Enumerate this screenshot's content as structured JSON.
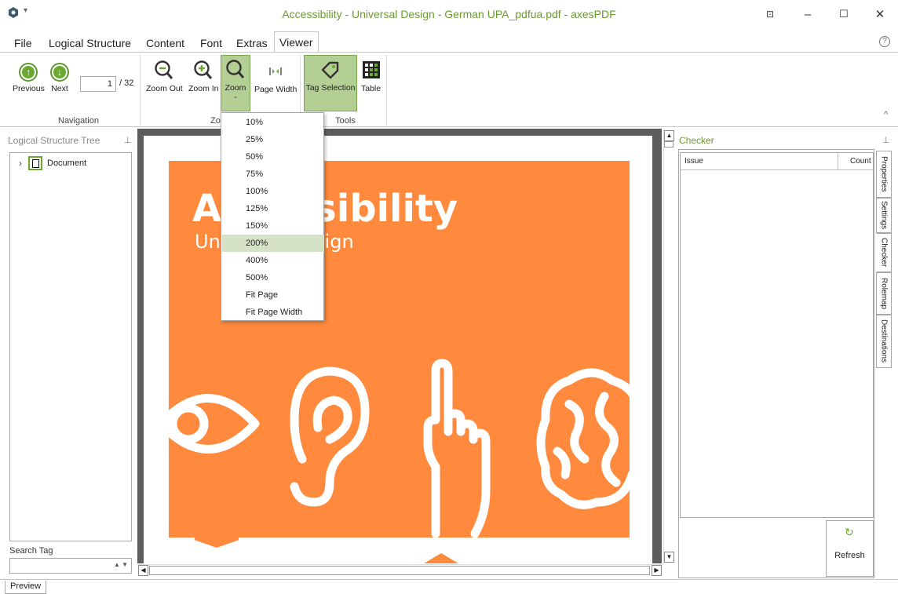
{
  "window": {
    "title": "Accessibility - Universal Design - German UPA_pdfua.pdf - axesPDF",
    "qa_dropdown": "▾",
    "buttons": {
      "restore": "⊡",
      "minimize": "–",
      "maximize": "☐",
      "close": "✕"
    }
  },
  "menu": {
    "file": "File",
    "logical_structure": "Logical Structure",
    "content": "Content",
    "font": "Font",
    "extras": "Extras",
    "viewer": "Viewer",
    "help": "?"
  },
  "ribbon": {
    "navigation": {
      "label": "Navigation",
      "previous": "Previous",
      "next": "Next",
      "page_value": "1",
      "page_total": "/ 32"
    },
    "zoom": {
      "label": "Zoom",
      "zoom_out": "Zoom Out",
      "zoom_in": "Zoom In",
      "zoom": "Zoom",
      "page_width": "Page Width"
    },
    "tools": {
      "label": "Tools",
      "tag_selection": "Tag Selection",
      "table": "Table"
    },
    "collapse": "^"
  },
  "left_panel": {
    "title": "Logical Structure Tree",
    "pin": "⊥",
    "tree": [
      {
        "label": "Document",
        "expand": "›"
      }
    ],
    "search_tag_label": "Search Tag",
    "search_tag_value": ""
  },
  "document": {
    "cover_title": "Accessibility",
    "cover_subtitle": "Universal Design",
    "accent_color": "#ff893c"
  },
  "zoom_dropdown": {
    "options": [
      "10%",
      "25%",
      "50%",
      "75%",
      "100%",
      "125%",
      "150%",
      "200%",
      "400%",
      "500%",
      "Fit Page",
      "Fit Page Width"
    ],
    "selected": "200%"
  },
  "right_panel": {
    "title": "Checker",
    "pin": "⊥",
    "columns": {
      "issue": "Issue",
      "count": "Count"
    },
    "refresh": "Refresh",
    "tabs": [
      "Properties",
      "Settings",
      "Checker",
      "Rolemap",
      "Destinations"
    ],
    "active_tab": "Checker"
  },
  "bottom": {
    "preview_tab": "Preview"
  },
  "theme": {
    "accent_green": "#6aa832",
    "title_green": "#6b9a2f",
    "selected_fill": "#b4cf94",
    "viewer_bg": "#5d5d5d"
  }
}
